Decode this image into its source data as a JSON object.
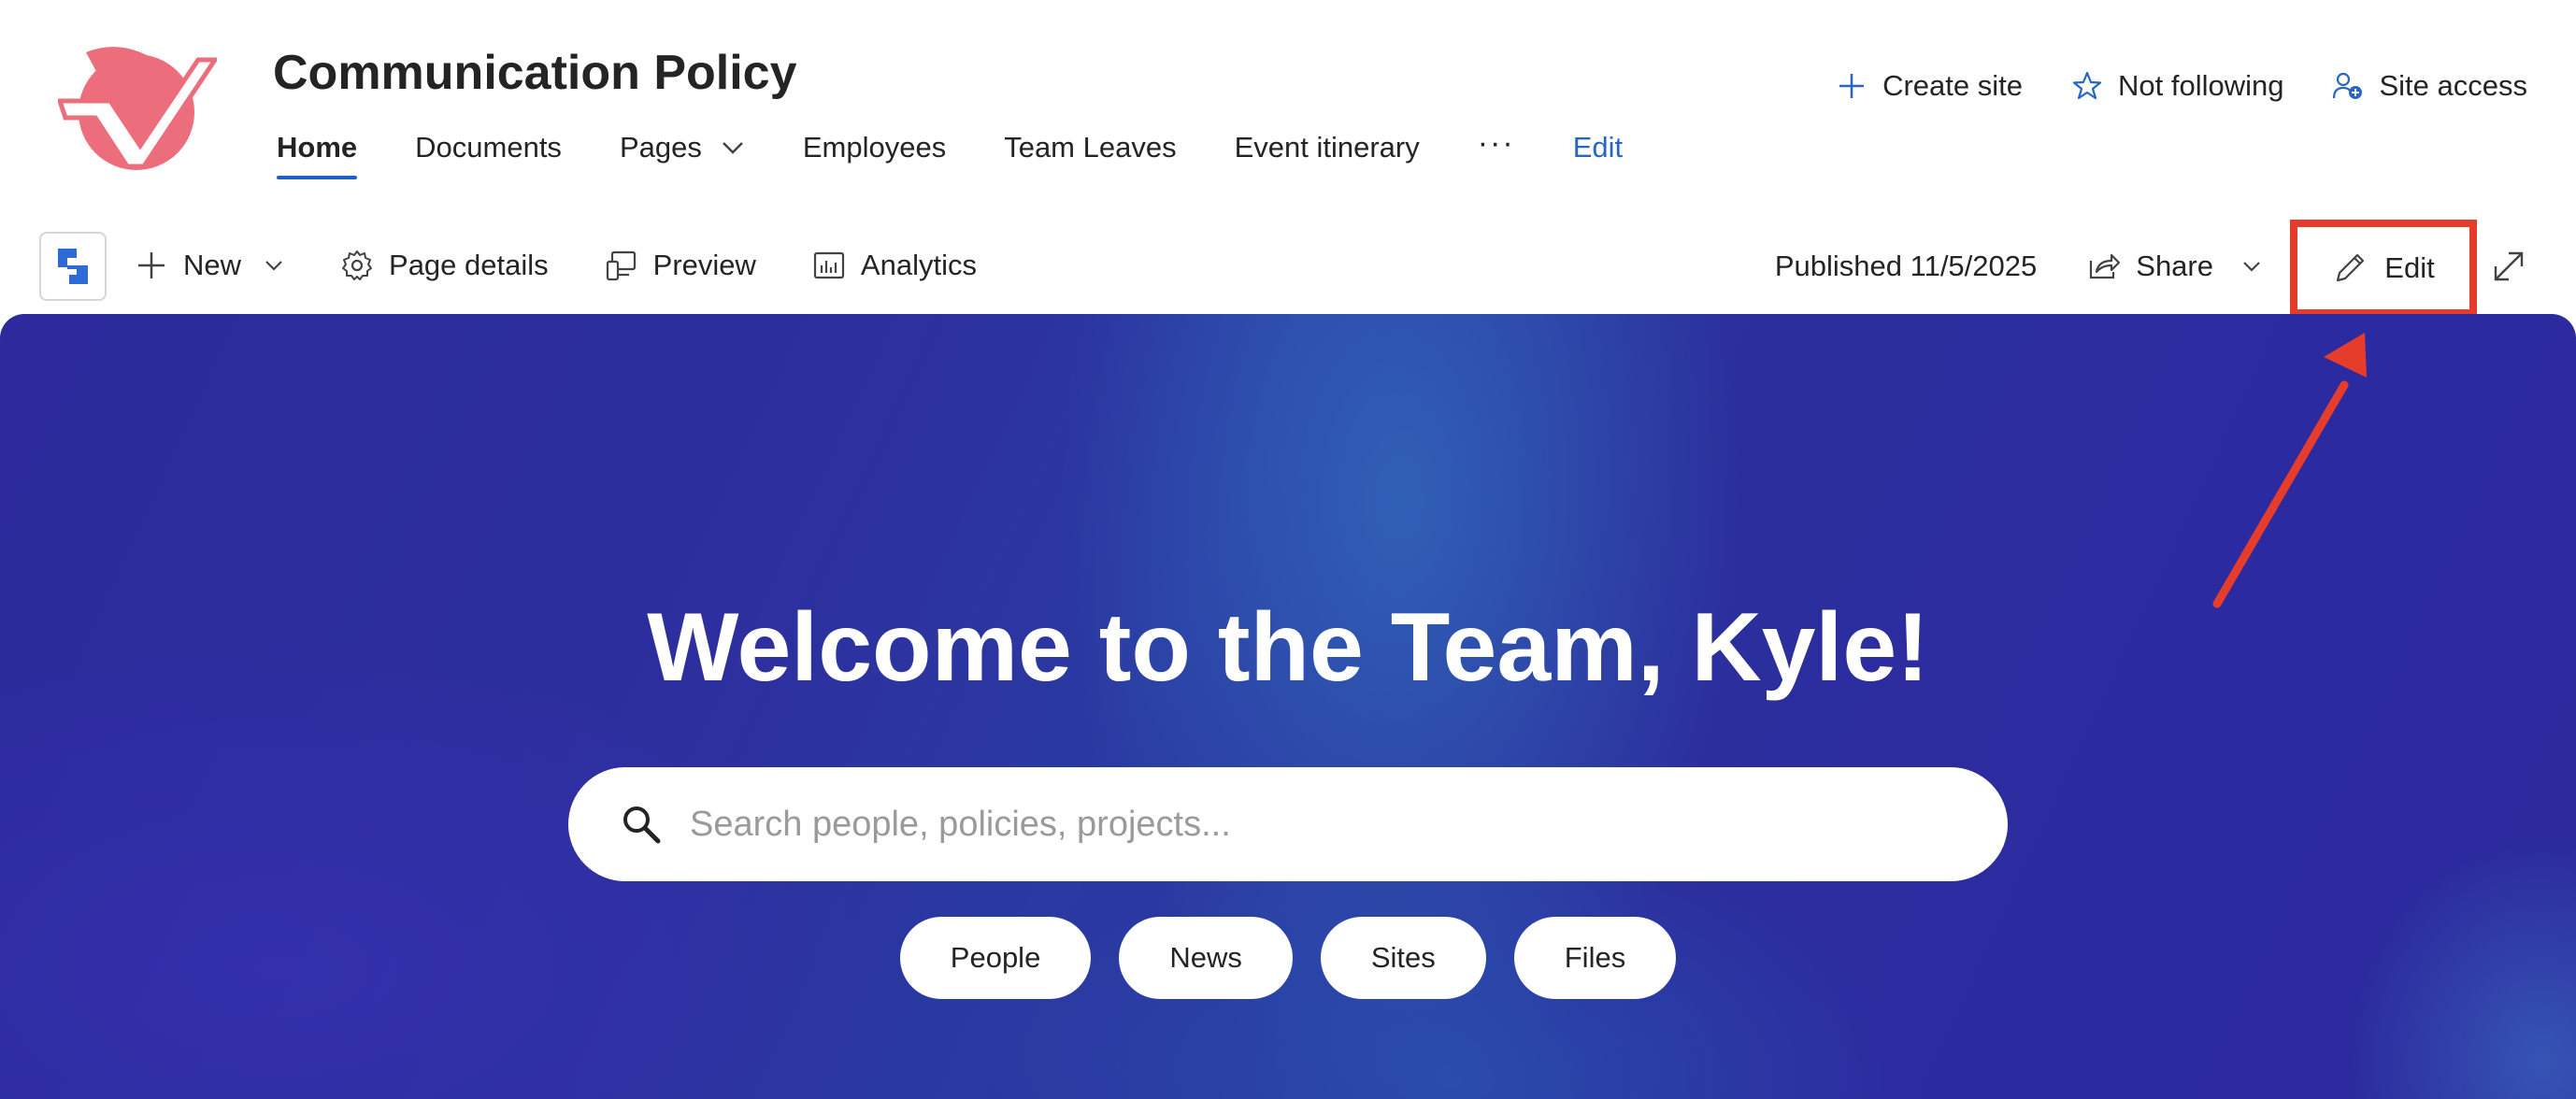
{
  "site": {
    "title": "Communication Policy",
    "brand_color": "#e95f6f"
  },
  "nav": {
    "items": [
      {
        "label": "Home",
        "active": true
      },
      {
        "label": "Documents"
      },
      {
        "label": "Pages",
        "has_dropdown": true
      },
      {
        "label": "Employees"
      },
      {
        "label": "Team Leaves"
      },
      {
        "label": "Event itinerary"
      }
    ],
    "more_label": "···",
    "edit_label": "Edit"
  },
  "top_actions": {
    "create_site": "Create site",
    "not_following": "Not following",
    "site_access": "Site access"
  },
  "command_bar": {
    "new_label": "New",
    "page_details_label": "Page details",
    "preview_label": "Preview",
    "analytics_label": "Analytics",
    "published_text": "Published 11/5/2025",
    "share_label": "Share",
    "edit_label": "Edit"
  },
  "hero": {
    "welcome": "Welcome to the Team, Kyle!",
    "search_placeholder": "Search people, policies, projects...",
    "chips": [
      "People",
      "News",
      "Sites",
      "Files"
    ]
  },
  "annotation": {
    "highlight_color": "#e53c2c",
    "target": "edit-button"
  }
}
